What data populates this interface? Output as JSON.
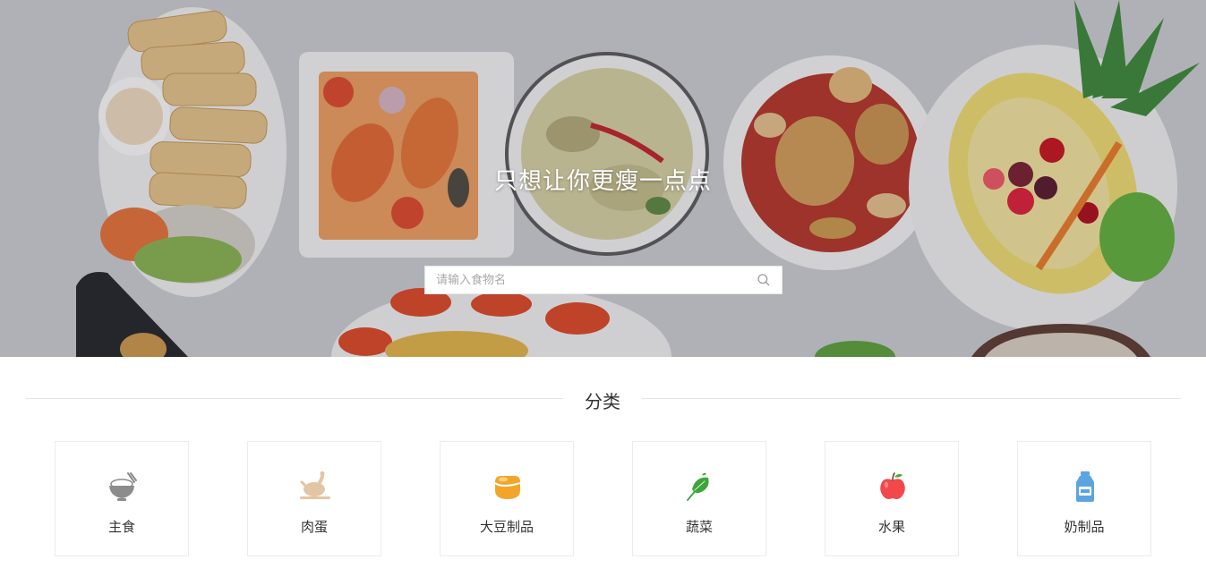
{
  "hero": {
    "title": "只想让你更瘦一点点",
    "search_placeholder": "请输入食物名",
    "search_value": ""
  },
  "category": {
    "title": "分类",
    "items": [
      {
        "label": "主食",
        "icon": "rice-bowl-icon",
        "color": "#8c8c8c"
      },
      {
        "label": "肉蛋",
        "icon": "roast-chicken-icon",
        "color": "#e2c6a3"
      },
      {
        "label": "大豆制品",
        "icon": "soybean-icon",
        "color": "#f3a52a"
      },
      {
        "label": "蔬菜",
        "icon": "leaf-icon",
        "color": "#3aa63a"
      },
      {
        "label": "水果",
        "icon": "apple-icon",
        "color": "#f2484c"
      },
      {
        "label": "奶制品",
        "icon": "milk-bottle-icon",
        "color": "#5ba4e0"
      }
    ]
  }
}
